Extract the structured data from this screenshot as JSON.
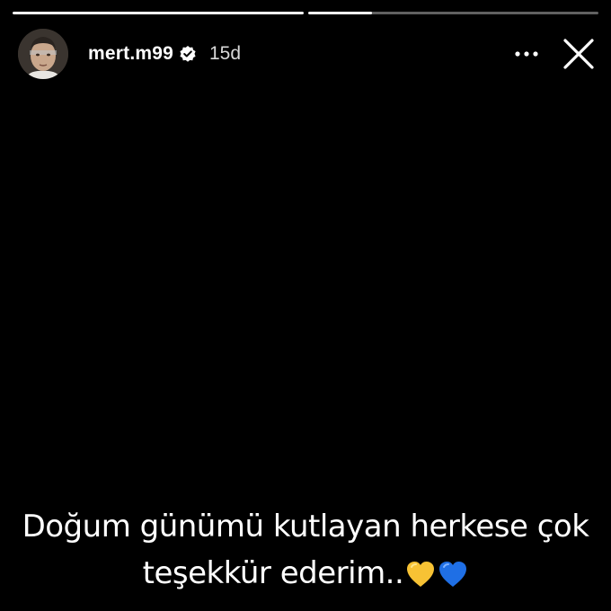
{
  "story": {
    "progress": [
      {
        "segment": 1,
        "filled": 1.0
      },
      {
        "segment": 2,
        "filled": 0.22
      }
    ],
    "username": "mert.m99",
    "verified": true,
    "time_ago": "15d",
    "more_icon": "more-horizontal-icon",
    "close_icon": "close-icon",
    "caption_line1": "Doğum günümü kutlayan herkese çok",
    "caption_line2": "teşekkür ederim..",
    "caption_emojis": [
      "yellow-heart",
      "blue-heart"
    ]
  },
  "colors": {
    "background": "#000000",
    "text": "#ffffff",
    "verified_badge": "#ffffff",
    "yellow_heart": "#f7c234",
    "blue_heart": "#1f6fe5"
  }
}
